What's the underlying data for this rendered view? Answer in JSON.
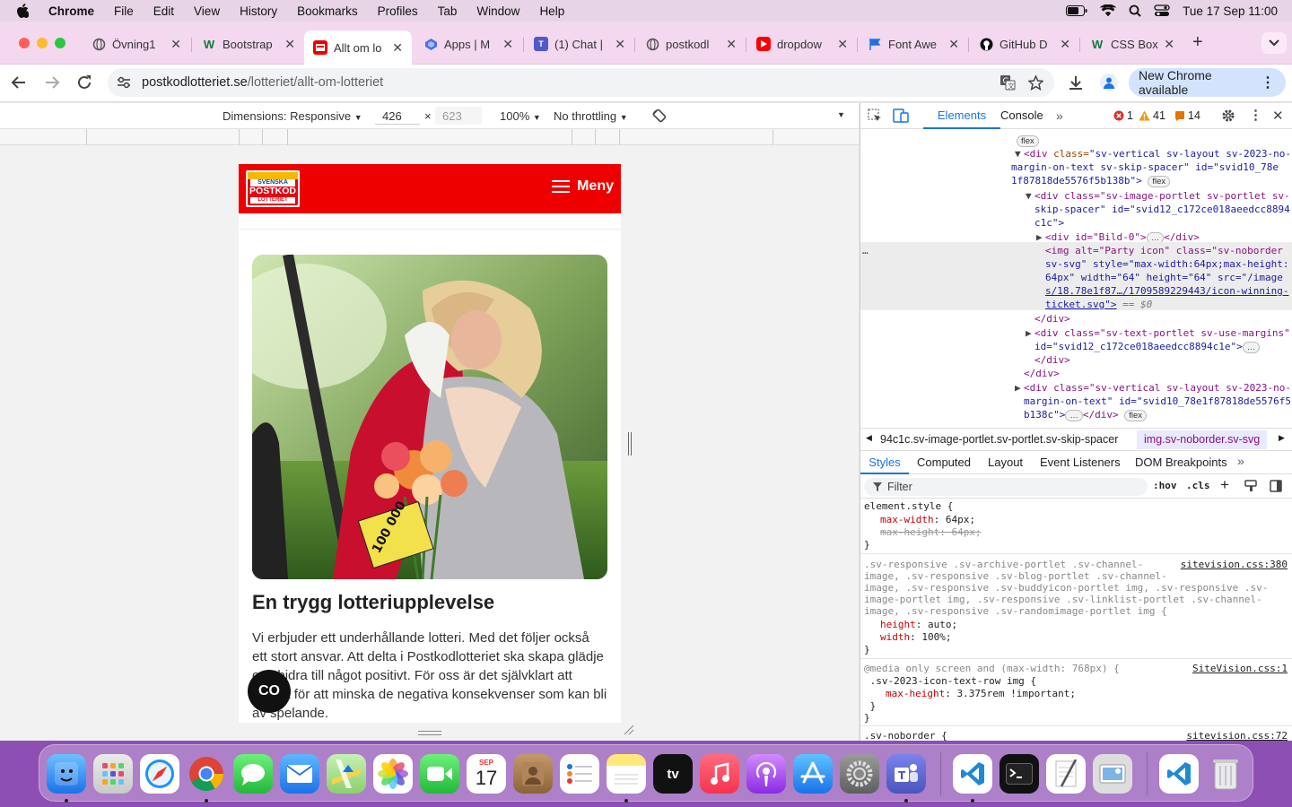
{
  "menubar": {
    "app": "Chrome",
    "items": [
      "File",
      "Edit",
      "View",
      "History",
      "Bookmarks",
      "Profiles",
      "Tab",
      "Window",
      "Help"
    ],
    "clock": "Tue 17 Sep  11:00"
  },
  "tabs": [
    {
      "title": "Övning1",
      "icon": "globe-icon",
      "color": "#666"
    },
    {
      "title": "Bootstrap",
      "icon": "w-icon",
      "color": "#0b7a3e"
    },
    {
      "title": "Allt om lo",
      "icon": "lottery-icon",
      "color": "#e00",
      "active": true
    },
    {
      "title": "Apps | M",
      "icon": "apps-icon",
      "color": "#5b6ee1"
    },
    {
      "title": "(1) Chat |",
      "icon": "teams-icon",
      "color": "#5059c9"
    },
    {
      "title": "postkodl",
      "icon": "globe-icon",
      "color": "#666"
    },
    {
      "title": "dropdow",
      "icon": "youtube-icon",
      "color": "#f00"
    },
    {
      "title": "Font Awe",
      "icon": "flag-icon",
      "color": "#1c73e8"
    },
    {
      "title": "GitHub D",
      "icon": "github-icon",
      "color": "#111"
    },
    {
      "title": "CSS Box",
      "icon": "w-icon",
      "color": "#0b7a3e"
    }
  ],
  "address": {
    "host": "postkodlotteriet.se",
    "path": "/lotteriet/allt-om-lotteriet"
  },
  "new_chrome": "New Chrome available",
  "device_toolbar": {
    "dimensions": "Dimensions: Responsive",
    "width": "426",
    "times": "×",
    "height": "623",
    "zoom": "100%",
    "throttling": "No throttling"
  },
  "page": {
    "logo_lines": [
      "SVENSKA",
      "POSTKOD",
      "LOTTERIET"
    ],
    "menu_label": "Meny",
    "heading": "En trygg lotteriupplevelse",
    "body": "Vi erbjuder ett underhållande lotteri. Med det följer också ett stort ansvar. Att delta i Postkodlotteriet ska skapa glädje och bidra till något positivt. För oss är det självklart att arbeta för att minska de negativa konsekvenser som kan bli av spelande.",
    "chat_label": "CO",
    "ticket_text": "100 000"
  },
  "devtools": {
    "tabs": [
      "Elements",
      "Console"
    ],
    "errors": "1",
    "warnings": "41",
    "issues": "14",
    "tree": {
      "l0": "flex",
      "l1a": "<div ",
      "l1b": "class=",
      "l1c": "\"sv-vertical sv-layout sv-2023-no-",
      "l2": "margin-on-text sv-skip-spacer\" id=\"svid10_78e",
      "l3": "1f87818de5576f5b138b\">",
      "l4": "<div class=\"sv-image-portlet sv-portlet sv-",
      "l5": "skip-spacer\" id=\"svid12_c172ce018aeedcc8894",
      "l6": "c1c\">",
      "l7": "<div id=\"Bild-0\">",
      "l7b": "</div>",
      "l8": "<img alt=\"Party icon\" class=\"sv-noborder",
      "l9": "sv-svg\" style=\"max-width:64px;max-height:",
      "l10": "64px\" width=\"64\" height=\"64\" src=\"/image",
      "l11": "s/18.78e1f87…/1709589229443/icon-winning-",
      "l12": "ticket.svg\">",
      "l12b": "== $0",
      "l13": "</div>",
      "l14": "<div class=\"sv-text-portlet sv-use-margins\"",
      "l15": "id=\"svid12_c172ce018aeedcc8894c1e\">",
      "l16": "</div>",
      "l17": "</div>",
      "l18": "<div class=\"sv-vertical sv-layout sv-2023-no-",
      "l19": "margin-on-text\" id=\"svid10_78e1f87818de5576f5",
      "l20": "b138c\">",
      "l20b": "</div>"
    },
    "crumb_a": "94c1c.sv-image-portlet.sv-portlet.sv-skip-spacer",
    "crumb_b": "img.sv-noborder.sv-svg",
    "subtabs": [
      "Styles",
      "Computed",
      "Layout",
      "Event Listeners",
      "DOM Breakpoints"
    ],
    "filter_placeholder": "Filter",
    "hov": ":hov",
    "cls": ".cls",
    "styles": {
      "s1": "element.style {",
      "s1a_n": "max-width",
      "s1a_v": "64px;",
      "s1b": "max-height: 64px;",
      "close": "}",
      "s2_l1": ".sv-responsive .sv-archive-portlet .sv-channel-",
      "s2_l2": "image, .sv-responsive .sv-blog-portlet .sv-channel-",
      "s2_l3": "image, .sv-responsive .sv-buddyicon-portlet img, .sv-responsive .sv-",
      "s2_l4": "image-portlet img, .sv-responsive .sv-linklist-portlet .sv-channel-",
      "s2_l5": "image, .sv-responsive .sv-randomimage-portlet img {",
      "s2_src": "sitevision.css:380",
      "s2a_n": "height",
      "s2a_v": "auto;",
      "s2b_n": "width",
      "s2b_v": "100%;",
      "s3_l1": "@media only screen and (max-width: 768px) {",
      "s3_src": "SiteVision.css:1",
      "s3_l2": " .sv-2023-icon-text-row img {",
      "s3a_n": "max-height",
      "s3a_v": "3.375rem !important;",
      "s3_c1": " }",
      "s4_l1": ".sv-noborder {",
      "s4_src": "sitevision.css:72"
    }
  },
  "dock": {
    "calendar_month": "SEP",
    "calendar_day": "17",
    "tv_label": "tv"
  }
}
